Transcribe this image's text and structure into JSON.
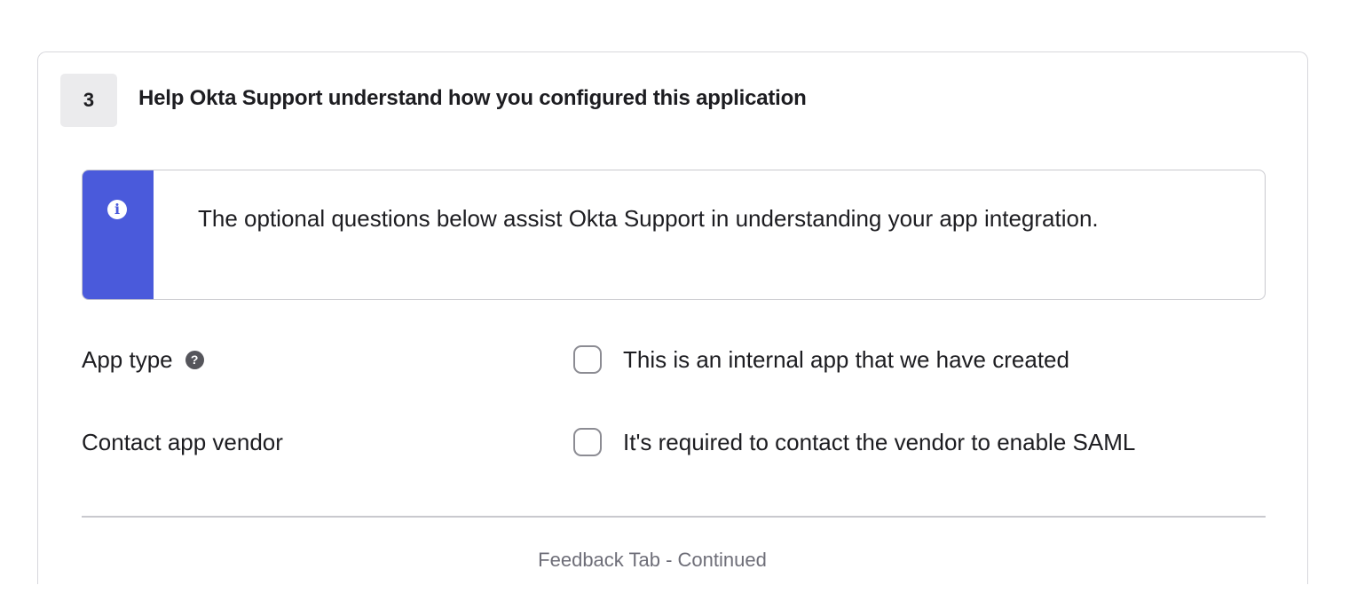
{
  "step": {
    "number": "3",
    "title": "Help Okta Support understand how you configured this application"
  },
  "callout": {
    "icon": "info-icon",
    "text": "The optional questions below assist Okta Support in understanding your app integration."
  },
  "fields": [
    {
      "label": "App type",
      "has_help": true,
      "checkbox_label": "This is an internal app that we have created",
      "checked": false
    },
    {
      "label": "Contact app vendor",
      "has_help": false,
      "checkbox_label": "It's required to contact the vendor to enable SAML",
      "checked": false
    }
  ],
  "caption": "Feedback Tab - Continued",
  "colors": {
    "accent": "#4a5adb",
    "badge_bg": "#ebebed",
    "border": "#d7d7dc",
    "caption": "#6e6e78"
  }
}
